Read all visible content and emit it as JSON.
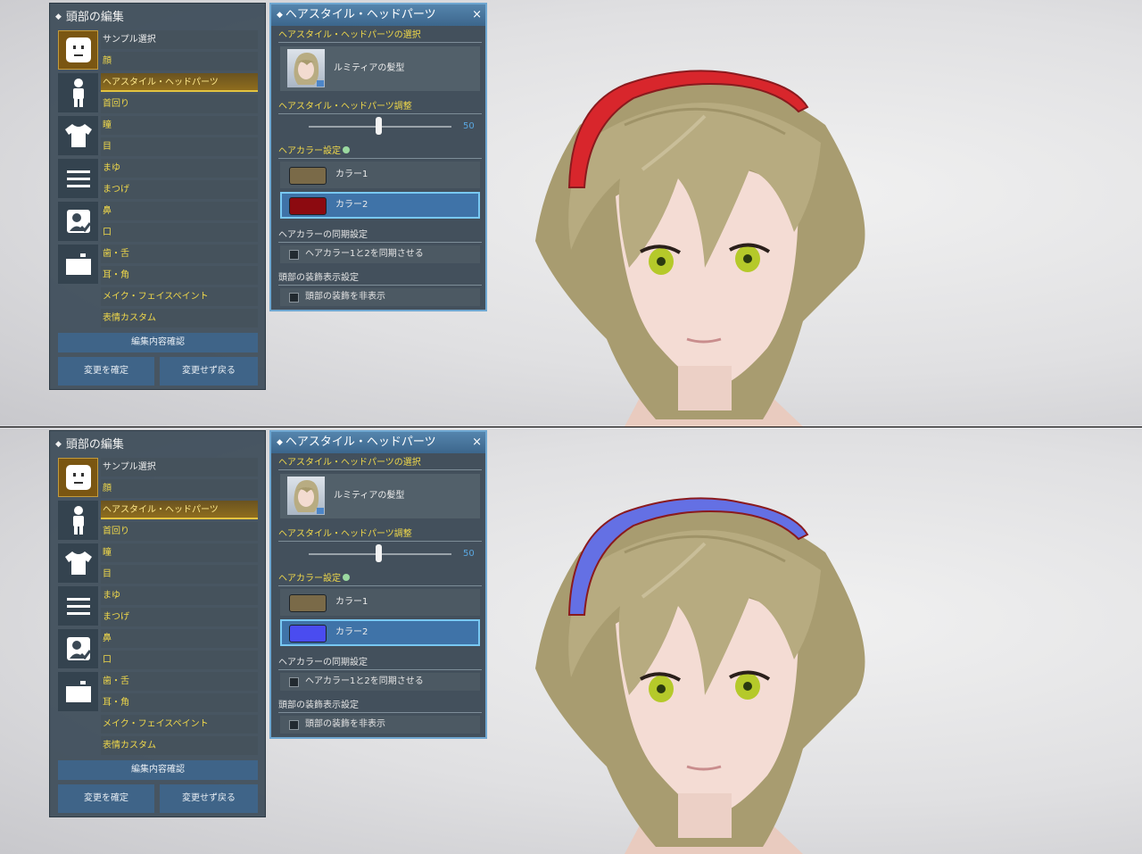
{
  "screens": [
    {
      "left_panel": {
        "title": "頭部の編集",
        "items": [
          "サンプル選択",
          "顔",
          "ヘアスタイル・ヘッドパーツ",
          "首回り",
          "瞳",
          "目",
          "まゆ",
          "まつげ",
          "鼻",
          "口",
          "歯・舌",
          "耳・角",
          "メイク・フェイスペイント",
          "表情カスタム"
        ],
        "confirm_label": "編集内容確認",
        "apply_label": "変更を確定",
        "cancel_label": "変更せず戻る"
      },
      "right_panel": {
        "title": "ヘアスタイル・ヘッドパーツ",
        "close_icon": "×",
        "select_header": "ヘアスタイル・ヘッドパーツの選択",
        "hair_name": "ルミティアの髪型",
        "adjust_header": "ヘアスタイル・ヘッドパーツ調整",
        "slider_value": "50",
        "color_header": "ヘアカラー設定",
        "color1_label": "カラー1",
        "color2_label": "カラー2",
        "sync_header": "ヘアカラーの同期設定",
        "sync_label": "ヘアカラー1と2を同期させる",
        "deco_header": "頭部の装飾表示設定",
        "deco_label": "頭部の装飾を非表示"
      },
      "colors": {
        "color1": "#7a6a48",
        "color2": "#8c0a10",
        "headband": "#d8262c"
      }
    },
    {
      "left_panel": {
        "title": "頭部の編集",
        "items": [
          "サンプル選択",
          "顔",
          "ヘアスタイル・ヘッドパーツ",
          "首回り",
          "瞳",
          "目",
          "まゆ",
          "まつげ",
          "鼻",
          "口",
          "歯・舌",
          "耳・角",
          "メイク・フェイスペイント",
          "表情カスタム"
        ],
        "confirm_label": "編集内容確認",
        "apply_label": "変更を確定",
        "cancel_label": "変更せず戻る"
      },
      "right_panel": {
        "title": "ヘアスタイル・ヘッドパーツ",
        "close_icon": "×",
        "select_header": "ヘアスタイル・ヘッドパーツの選択",
        "hair_name": "ルミティアの髪型",
        "adjust_header": "ヘアスタイル・ヘッドパーツ調整",
        "slider_value": "50",
        "color_header": "ヘアカラー設定",
        "color1_label": "カラー1",
        "color2_label": "カラー2",
        "sync_header": "ヘアカラーの同期設定",
        "sync_label": "ヘアカラー1と2を同期させる",
        "deco_header": "頭部の装飾表示設定",
        "deco_label": "頭部の装飾を非表示"
      },
      "colors": {
        "color1": "#7a6a48",
        "color2": "#4a4cf0",
        "headband": "#6470e4"
      }
    }
  ]
}
